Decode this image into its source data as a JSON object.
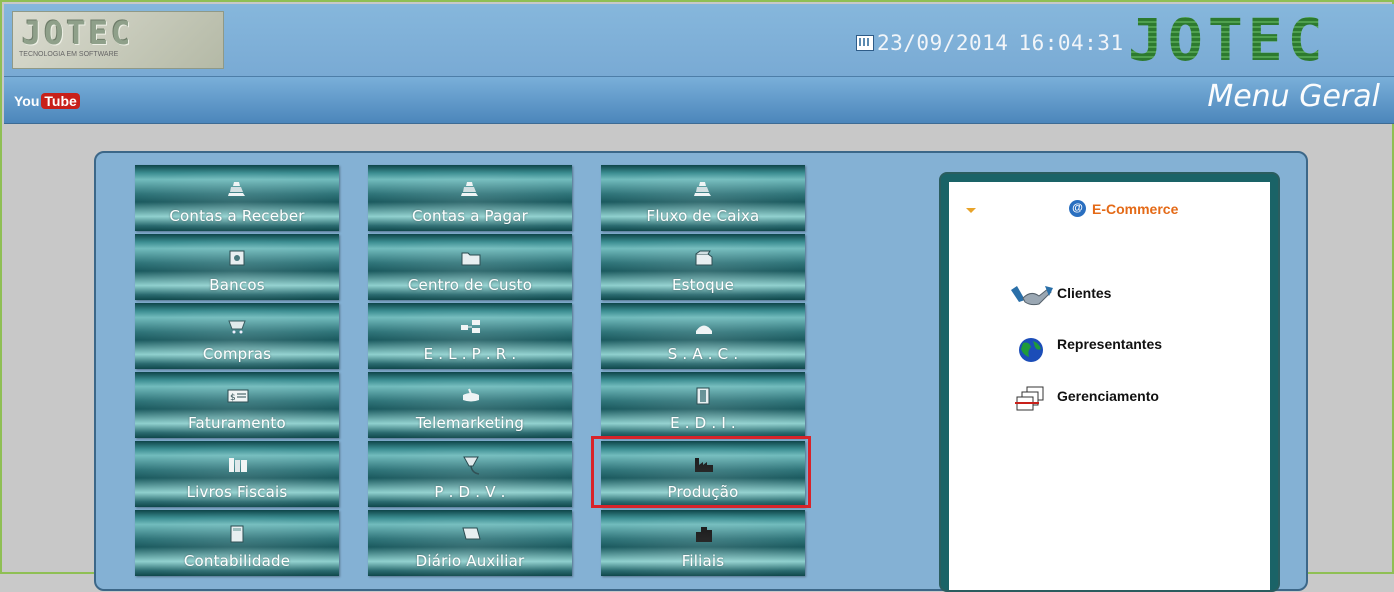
{
  "header": {
    "logo_text": "JOTEC",
    "logo_tagline": "TECNOLOGIA EM SOFTWARE",
    "date": "23/09/2014",
    "time": "16:04:31",
    "brand": "JOTEC"
  },
  "subheader": {
    "youtube_you": "You",
    "youtube_tube": "Tube",
    "title": "Menu Geral"
  },
  "menu": {
    "buttons": [
      {
        "label": "Contas a Receber",
        "icon": "register-icon"
      },
      {
        "label": "Contas a Pagar",
        "icon": "register-icon"
      },
      {
        "label": "Fluxo de Caixa",
        "icon": "register-icon"
      },
      {
        "label": "Bancos",
        "icon": "safe-icon"
      },
      {
        "label": "Centro de Custo",
        "icon": "folder-icon"
      },
      {
        "label": "Estoque",
        "icon": "box-icon"
      },
      {
        "label": "Compras",
        "icon": "cart-icon"
      },
      {
        "label": "E . L . P . R .",
        "icon": "network-icon"
      },
      {
        "label": "S . A . C .",
        "icon": "phone-icon"
      },
      {
        "label": "Faturamento",
        "icon": "invoice-icon"
      },
      {
        "label": "Telemarketing",
        "icon": "telephone-icon"
      },
      {
        "label": "E . D . I .",
        "icon": "film-icon"
      },
      {
        "label": "Livros Fiscais",
        "icon": "books-icon"
      },
      {
        "label": "P . D . V .",
        "icon": "scanner-icon"
      },
      {
        "label": "Produção",
        "icon": "factory-icon"
      },
      {
        "label": "Contabilidade",
        "icon": "calculator-icon"
      },
      {
        "label": "Diário Auxiliar",
        "icon": "book-icon"
      },
      {
        "label": "Filiais",
        "icon": "buildings-icon"
      }
    ]
  },
  "ecommerce": {
    "title": "E-Commerce",
    "items": [
      {
        "label": "Clientes",
        "icon": "handshake-icon"
      },
      {
        "label": "Representantes",
        "icon": "globe-icon"
      },
      {
        "label": "Gerenciamento",
        "icon": "windows-icon"
      }
    ]
  },
  "colors": {
    "highlight": "#d8232a",
    "ecommerce_title": "#e46a17",
    "brand_green": "#2d7a2f"
  }
}
